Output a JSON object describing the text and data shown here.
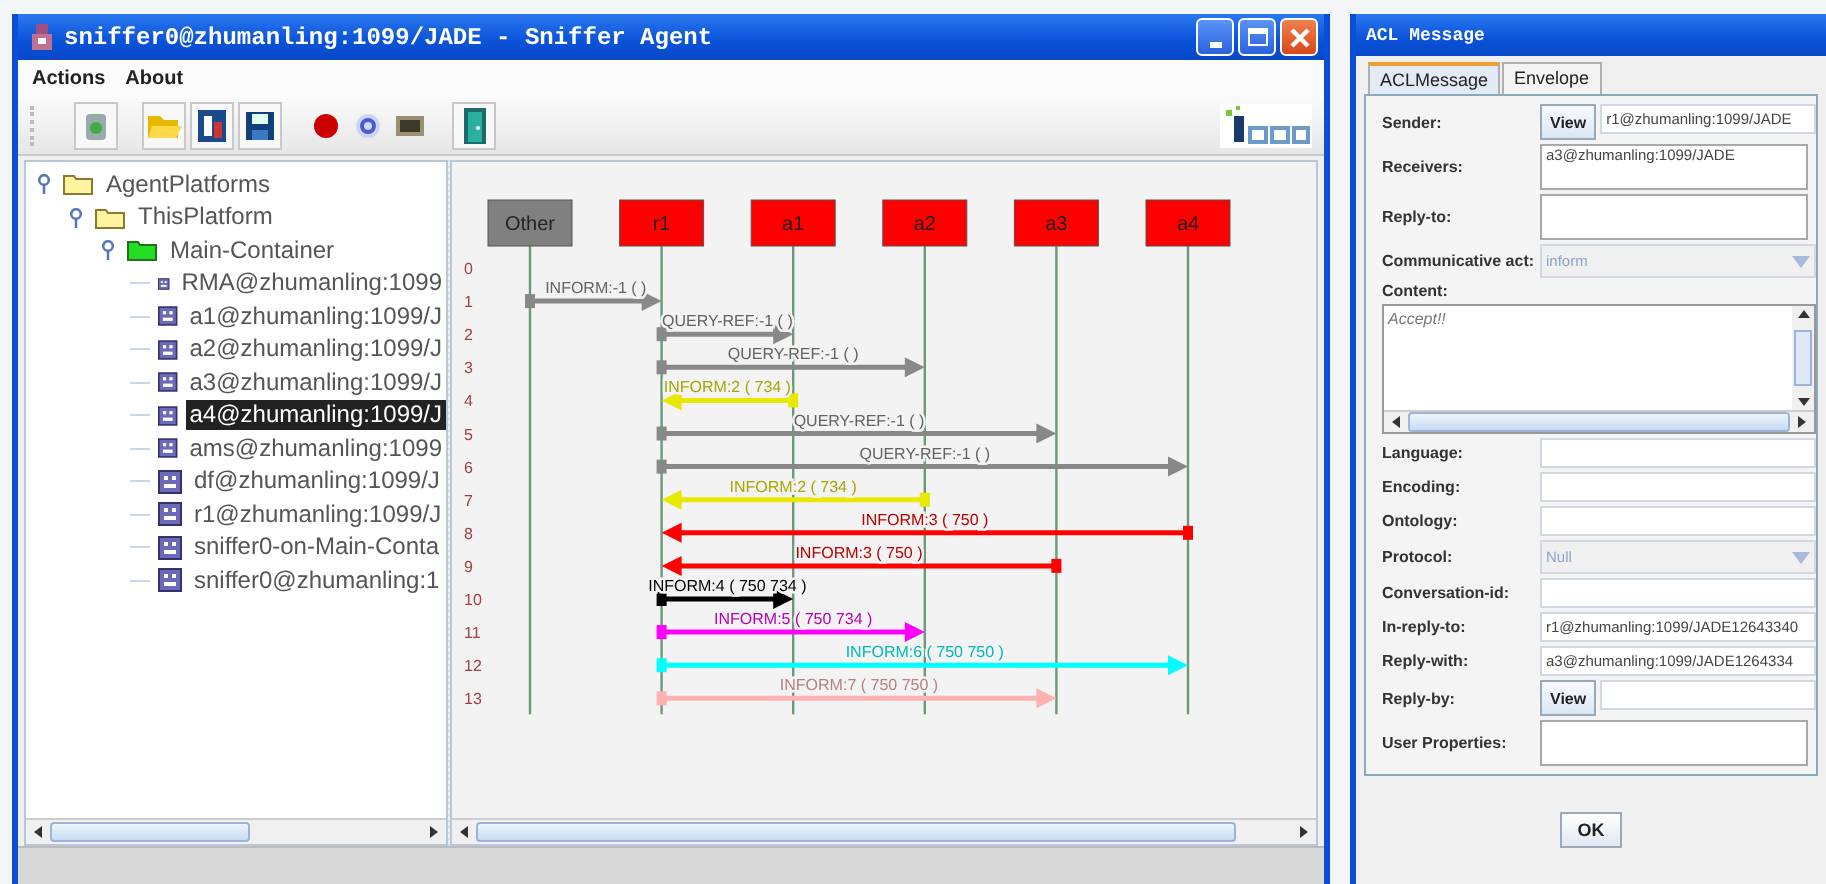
{
  "window": {
    "title": "sniffer0@zhumanling:1099/JADE - Sniffer Agent"
  },
  "menu": [
    "Actions",
    "About"
  ],
  "tree": [
    {
      "label": "AgentPlatforms",
      "kind": "folder",
      "expanded": true,
      "selected": false,
      "children": [
        {
          "label": "ThisPlatform",
          "kind": "folder",
          "expanded": true,
          "selected": false,
          "children": [
            {
              "label": "Main-Container",
              "kind": "container",
              "expanded": true,
              "selected": false,
              "children": [
                {
                  "label": "RMA@zhumanling:1099",
                  "kind": "agent",
                  "selected": false
                },
                {
                  "label": "a1@zhumanling:1099/J",
                  "kind": "agent",
                  "selected": false
                },
                {
                  "label": "a2@zhumanling:1099/J",
                  "kind": "agent",
                  "selected": false
                },
                {
                  "label": "a3@zhumanling:1099/J",
                  "kind": "agent",
                  "selected": false
                },
                {
                  "label": "a4@zhumanling:1099/J",
                  "kind": "agent",
                  "selected": true
                },
                {
                  "label": "ams@zhumanling:1099",
                  "kind": "agent",
                  "selected": false
                },
                {
                  "label": "df@zhumanling:1099/J",
                  "kind": "agent",
                  "selected": false
                },
                {
                  "label": "r1@zhumanling:1099/J",
                  "kind": "agent",
                  "selected": false
                },
                {
                  "label": "sniffer0-on-Main-Conta",
                  "kind": "agent",
                  "selected": false
                },
                {
                  "label": "sniffer0@zhumanling:1",
                  "kind": "agent",
                  "selected": false
                }
              ]
            }
          ]
        }
      ]
    }
  ],
  "diagram": {
    "agents": [
      {
        "name": "Other",
        "color": "#808080"
      },
      {
        "name": "r1",
        "color": "#ff0000"
      },
      {
        "name": "a1",
        "color": "#ff0000"
      },
      {
        "name": "a2",
        "color": "#ff0000"
      },
      {
        "name": "a3",
        "color": "#ff0000"
      },
      {
        "name": "a4",
        "color": "#ff0000"
      }
    ],
    "row_numbers": [
      "0",
      "1",
      "2",
      "3",
      "4",
      "5",
      "6",
      "7",
      "8",
      "9",
      "10",
      "11",
      "12",
      "13"
    ],
    "messages": [
      {
        "label": "INFORM:-1 (      )",
        "color": "#888888",
        "lanes": [
          {
            "kind": "send"
          },
          {
            "kind": "receive"
          },
          {
            "kind": "idle"
          },
          {
            "kind": "idle"
          },
          {
            "kind": "idle"
          },
          {
            "kind": "idle"
          }
        ]
      },
      {
        "label": "QUERY-REF:-1 (      )",
        "color": "#888888",
        "lanes": [
          {
            "kind": "idle"
          },
          {
            "kind": "send"
          },
          {
            "kind": "receive"
          },
          {
            "kind": "idle"
          },
          {
            "kind": "idle"
          },
          {
            "kind": "idle"
          }
        ]
      },
      {
        "label": "QUERY-REF:-1 (      )",
        "color": "#888888",
        "lanes": [
          {
            "kind": "idle"
          },
          {
            "kind": "send"
          },
          {
            "kind": "idle"
          },
          {
            "kind": "receive"
          },
          {
            "kind": "idle"
          },
          {
            "kind": "idle"
          }
        ]
      },
      {
        "label": "INFORM:2 (  734   )",
        "color": "#e8e800",
        "lanes": [
          {
            "kind": "idle"
          },
          {
            "kind": "receive"
          },
          {
            "kind": "send"
          },
          {
            "kind": "idle"
          },
          {
            "kind": "idle"
          },
          {
            "kind": "idle"
          }
        ]
      },
      {
        "label": "QUERY-REF:-1 (      )",
        "color": "#888888",
        "lanes": [
          {
            "kind": "idle"
          },
          {
            "kind": "send"
          },
          {
            "kind": "idle"
          },
          {
            "kind": "idle"
          },
          {
            "kind": "receive"
          },
          {
            "kind": "idle"
          }
        ]
      },
      {
        "label": "QUERY-REF:-1 (      )",
        "color": "#888888",
        "lanes": [
          {
            "kind": "idle"
          },
          {
            "kind": "send"
          },
          {
            "kind": "idle"
          },
          {
            "kind": "idle"
          },
          {
            "kind": "idle"
          },
          {
            "kind": "receive"
          }
        ]
      },
      {
        "label": "INFORM:2 (  734   )",
        "color": "#e8e800",
        "lanes": [
          {
            "kind": "idle"
          },
          {
            "kind": "receive"
          },
          {
            "kind": "idle"
          },
          {
            "kind": "send"
          },
          {
            "kind": "idle"
          },
          {
            "kind": "idle"
          }
        ]
      },
      {
        "label": "INFORM:3 (  750   )",
        "color": "#ff0000",
        "lanes": [
          {
            "kind": "idle"
          },
          {
            "kind": "receive"
          },
          {
            "kind": "idle"
          },
          {
            "kind": "idle"
          },
          {
            "kind": "idle"
          },
          {
            "kind": "send"
          }
        ]
      },
      {
        "label": "INFORM:3 (  750   )",
        "color": "#ff0000",
        "lanes": [
          {
            "kind": "idle"
          },
          {
            "kind": "receive"
          },
          {
            "kind": "idle"
          },
          {
            "kind": "idle"
          },
          {
            "kind": "send"
          },
          {
            "kind": "idle"
          }
        ]
      },
      {
        "label": "INFORM:4 (  750  734 )",
        "color": "#000000",
        "lanes": [
          {
            "kind": "idle"
          },
          {
            "kind": "send"
          },
          {
            "kind": "receive"
          },
          {
            "kind": "idle"
          },
          {
            "kind": "idle"
          },
          {
            "kind": "idle"
          }
        ]
      },
      {
        "label": "INFORM:5 (  750  734 )",
        "color": "#ff00ff",
        "lanes": [
          {
            "kind": "idle"
          },
          {
            "kind": "send"
          },
          {
            "kind": "idle"
          },
          {
            "kind": "receive"
          },
          {
            "kind": "idle"
          },
          {
            "kind": "idle"
          }
        ]
      },
      {
        "label": "INFORM:6 (  750  750 )",
        "color": "#00ffff",
        "lanes": [
          {
            "kind": "idle"
          },
          {
            "kind": "send"
          },
          {
            "kind": "idle"
          },
          {
            "kind": "idle"
          },
          {
            "kind": "idle"
          },
          {
            "kind": "receive"
          }
        ]
      },
      {
        "label": "INFORM:7 (  750  750 )",
        "color": "#ffb0b0",
        "lanes": [
          {
            "kind": "idle"
          },
          {
            "kind": "send"
          },
          {
            "kind": "idle"
          },
          {
            "kind": "idle"
          },
          {
            "kind": "receive"
          },
          {
            "kind": "idle"
          }
        ]
      }
    ]
  },
  "dialog": {
    "title": "ACL Message",
    "tabs": [
      {
        "label": "ACLMessage",
        "selected": true
      },
      {
        "label": "Envelope",
        "selected": false
      }
    ],
    "fields": [
      {
        "label": "Sender:",
        "kind": "view",
        "button": "View",
        "value": "r1@zhumanling:1099/JADE"
      },
      {
        "label": "Receivers:",
        "kind": "area",
        "value": "a3@zhumanling:1099/JADE"
      },
      {
        "label": "Reply-to:",
        "kind": "area"
      },
      {
        "label": "Communicative act:",
        "kind": "combo",
        "value": "inform"
      },
      {
        "label": "Content:",
        "kind": "content",
        "value": "Accept!!"
      },
      {
        "label": "Language:",
        "kind": "text"
      },
      {
        "label": "Encoding:",
        "kind": "text"
      },
      {
        "label": "Ontology:",
        "kind": "text"
      },
      {
        "label": "Protocol:",
        "kind": "combo",
        "value": "Null"
      },
      {
        "label": "Conversation-id:",
        "kind": "text"
      },
      {
        "label": "In-reply-to:",
        "kind": "text",
        "value": "r1@zhumanling:1099/JADE12643340"
      },
      {
        "label": "Reply-with:",
        "kind": "text",
        "value": "a3@zhumanling:1099/JADE1264334"
      },
      {
        "label": "Reply-by:",
        "kind": "view",
        "button": "View"
      },
      {
        "label": "User Properties:",
        "kind": "area"
      }
    ],
    "ok": "OK"
  }
}
